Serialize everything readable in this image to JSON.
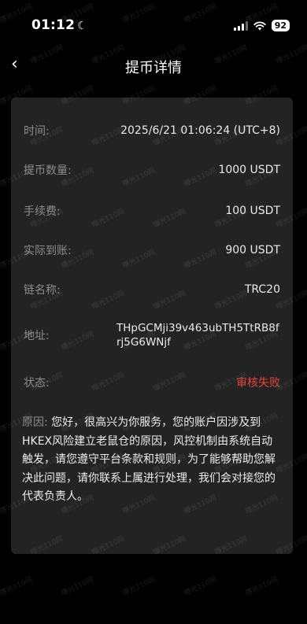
{
  "status_bar": {
    "time": "01:12",
    "battery": "92"
  },
  "nav": {
    "title": "提币详情",
    "back_icon": "‹"
  },
  "details": {
    "time_label": "时间:",
    "time_value": "2025/6/21 01:06:24 (UTC+8)",
    "amount_label": "提币数量:",
    "amount_value": "1000 USDT",
    "fee_label": "手续费:",
    "fee_value": "100 USDT",
    "received_label": "实际到账:",
    "received_value": "900 USDT",
    "chain_label": "链名称:",
    "chain_value": "TRC20",
    "address_label": "地址:",
    "address_value": "THpGCMji39v463ubTH5TtRB8frj5G6WNjf",
    "status_label": "状态:",
    "status_value": "审核失败",
    "reason_label": "原因:",
    "reason_text": "您好，很高兴为你服务，您的账户因涉及到HKEX风险建立老鼠仓的原因，风控机制由系统自动触发，请您遵守平台条款和规则，为了能够帮助您解决此问题，请你联系上属进行处理，我们会对接您的代表负责人。"
  },
  "watermark": {
    "text": "曝光110网"
  },
  "colors": {
    "status_failed": "#e0473c",
    "card_bg": "#232323"
  }
}
